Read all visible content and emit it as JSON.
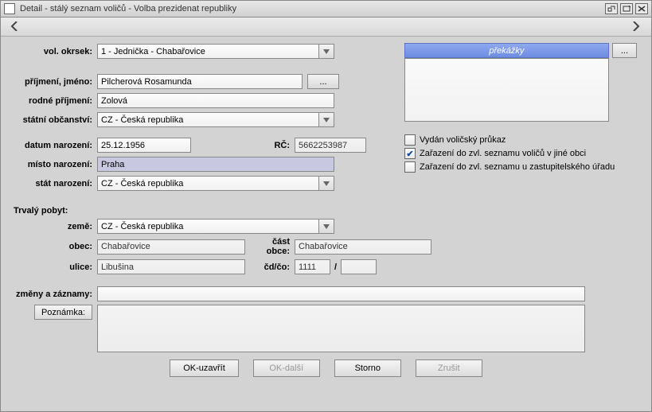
{
  "window": {
    "title": "Detail - stálý seznam voličů - Volba prezidenat republiky"
  },
  "labels": {
    "vol_okrsek": "vol. okrsek:",
    "prijmeni_jmeno": "příjmení, jméno:",
    "rodne_prijmeni": "rodné příjmení:",
    "statni_obcanstvi": "státní občanství:",
    "datum_narozeni": "datum narození:",
    "rc": "RČ:",
    "misto_narozeni": "místo narození:",
    "stat_narozeni": "stát narození:",
    "trvaly_pobyt": "Trvalý pobyt:",
    "zeme": "země:",
    "obec": "obec:",
    "cast_obce": "část obce:",
    "ulice": "ulice:",
    "cd_co": "čd/čo:",
    "zmeny_zaznamy": "změny a záznamy:",
    "poznamka": "Poznámka:"
  },
  "values": {
    "vol_okrsek": "1 - Jednička - Chabařovice",
    "prijmeni_jmeno": "Pilcherová Rosamunda",
    "rodne_prijmeni": "Zolová",
    "statni_obcanstvi": "CZ - Česká republika",
    "datum_narozeni": "25.12.1956",
    "rc": "5662253987",
    "misto_narozeni": "Praha",
    "stat_narozeni": "CZ - Česká republika",
    "zeme": "CZ - Česká republika",
    "obec": "Chabařovice",
    "cast_obce": "Chabařovice",
    "ulice": "Libušina",
    "cd": "1111",
    "cd_sep": "/",
    "co": "",
    "zmeny_zaznamy": "",
    "poznamka": ""
  },
  "right": {
    "prekazky_header": "překážky",
    "cb_vydan": "Vydán voličský průkaz",
    "cb_zarazeni_jine": "Zařazení do zvl. seznamu voličů v jiné obci",
    "cb_zarazeni_zast": "Zařazení do zvl. seznamu u zastupitelského úřadu"
  },
  "buttons": {
    "dots": "...",
    "ok_uzavrit": "OK-uzavřít",
    "ok_dalsi": "OK-další",
    "storno": "Storno",
    "zrusit": "Zrušit"
  },
  "checks": {
    "vydan": false,
    "zarazeni_jine": true,
    "zarazeni_zast": false
  }
}
